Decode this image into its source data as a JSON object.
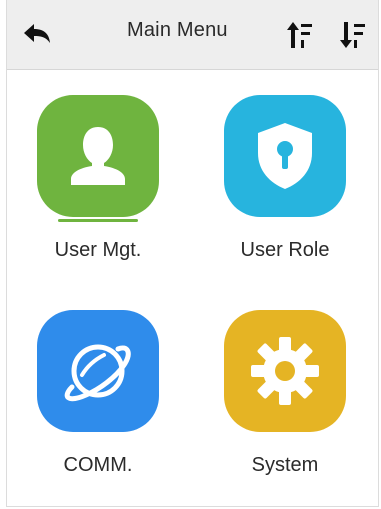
{
  "header": {
    "title": "Main Menu"
  },
  "menu": {
    "items": [
      {
        "label": "User Mgt.",
        "icon": "user-icon",
        "color": "#6fb43f"
      },
      {
        "label": "User Role",
        "icon": "shield-keyhole-icon",
        "color": "#27b4de"
      },
      {
        "label": "COMM.",
        "icon": "planet-icon",
        "color": "#2f8ceb"
      },
      {
        "label": "System",
        "icon": "gear-icon",
        "color": "#e5b424"
      }
    ],
    "selected_index": 0
  },
  "colors": {
    "header_bg": "#eeeeee",
    "selection_indicator": "#6fb43f"
  }
}
